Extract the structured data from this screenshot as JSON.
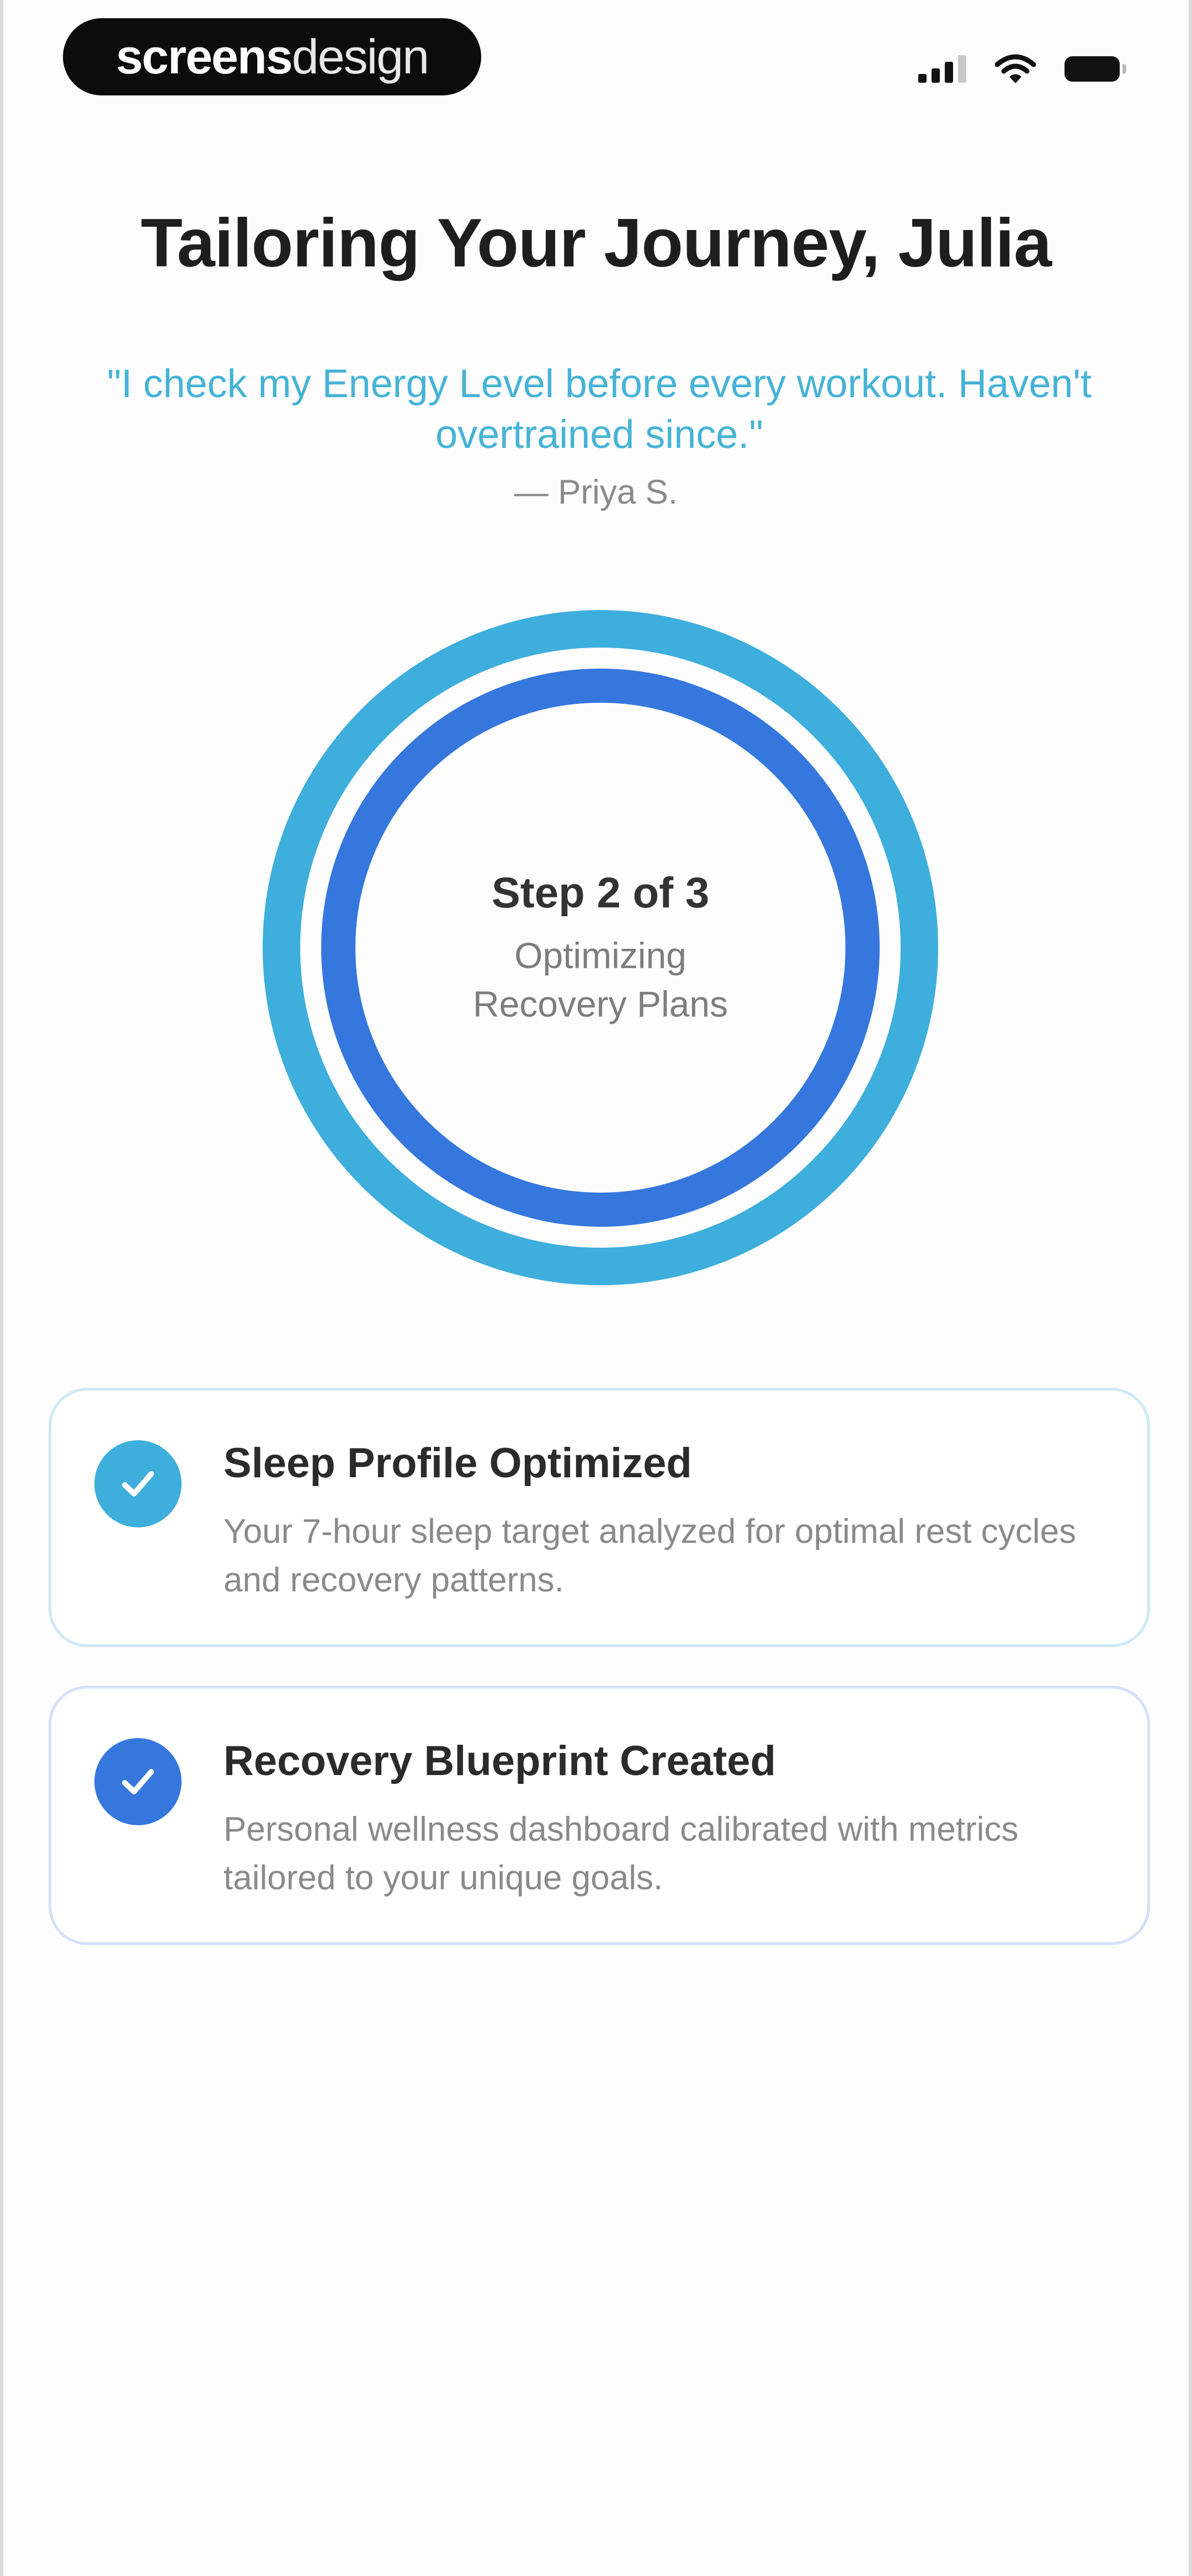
{
  "status_bar": {
    "brand_bold": "screens",
    "brand_light": "design",
    "icons": [
      "signal-icon",
      "wifi-icon",
      "battery-icon"
    ]
  },
  "header": {
    "title": "Tailoring Your Journey, Julia",
    "quote": "\"I check my Energy Level before every workout. Haven't overtrained since.\"",
    "quote_author": "— Priya S."
  },
  "progress": {
    "step_label": "Step 2 of 3",
    "current_task": "Optimizing Recovery Plans",
    "current_step": 2,
    "total_steps": 3,
    "colors": {
      "outer_ring": "#3eaedc",
      "inner_ring": "#3577dd"
    }
  },
  "tasks": [
    {
      "title": "Sleep Profile Optimized",
      "description": "Your 7-hour sleep target analyzed for optimal rest cycles and recovery patterns.",
      "status": "complete",
      "icon": "check-icon",
      "color": "#3eaedc"
    },
    {
      "title": "Recovery Blueprint Created",
      "description": "Personal wellness dashboard calibrated with metrics tailored to your unique goals.",
      "status": "complete",
      "icon": "check-icon",
      "color": "#3577dd"
    }
  ]
}
